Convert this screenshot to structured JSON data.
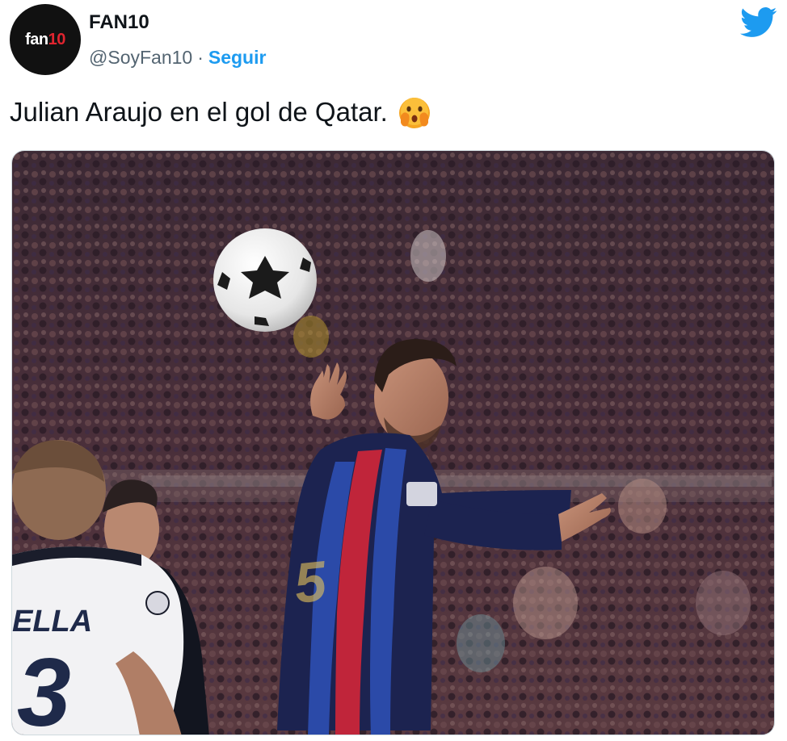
{
  "author": {
    "avatar_logo_main": "fan",
    "avatar_logo_accent": "10",
    "name": "FAN10",
    "handle": "@SoyFan10",
    "separator": "·",
    "follow_label": "Seguir"
  },
  "tweet": {
    "text": "Julian Araujo en el gol de Qatar."
  },
  "media": {
    "jersey_name": "ELLA",
    "jersey_number": "3"
  },
  "colors": {
    "link_blue": "#1d9bf0",
    "twitter_blue": "#1d9bf0",
    "text_primary": "#0f1419",
    "text_secondary": "#536471"
  },
  "icons": {
    "brand": "twitter-bird-icon",
    "emoji": "hushed-face-hands-emoji"
  }
}
